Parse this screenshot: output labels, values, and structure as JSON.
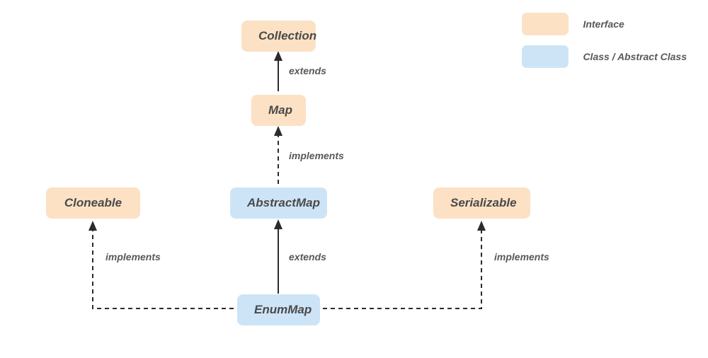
{
  "nodes": {
    "collection": {
      "label": "Collection",
      "type": "interface"
    },
    "map": {
      "label": "Map",
      "type": "interface"
    },
    "abstractmap": {
      "label": "AbstractMap",
      "type": "class"
    },
    "enummap": {
      "label": "EnumMap",
      "type": "class"
    },
    "cloneable": {
      "label": "Cloneable",
      "type": "interface"
    },
    "serializable": {
      "label": "Serializable",
      "type": "interface"
    }
  },
  "edges": {
    "map_collection": {
      "label": "extends",
      "style": "solid"
    },
    "abstractmap_map": {
      "label": "implements",
      "style": "dashed"
    },
    "enummap_abstractmap": {
      "label": "extends",
      "style": "solid"
    },
    "enummap_cloneable": {
      "label": "implements",
      "style": "dashed"
    },
    "enummap_serializable": {
      "label": "implements",
      "style": "dashed"
    }
  },
  "legend": {
    "interface_label": "Interface",
    "class_label": "Class / Abstract Class"
  },
  "colors": {
    "interface": "#fce1c5",
    "class": "#cde4f7",
    "line": "#2b2b2b"
  }
}
